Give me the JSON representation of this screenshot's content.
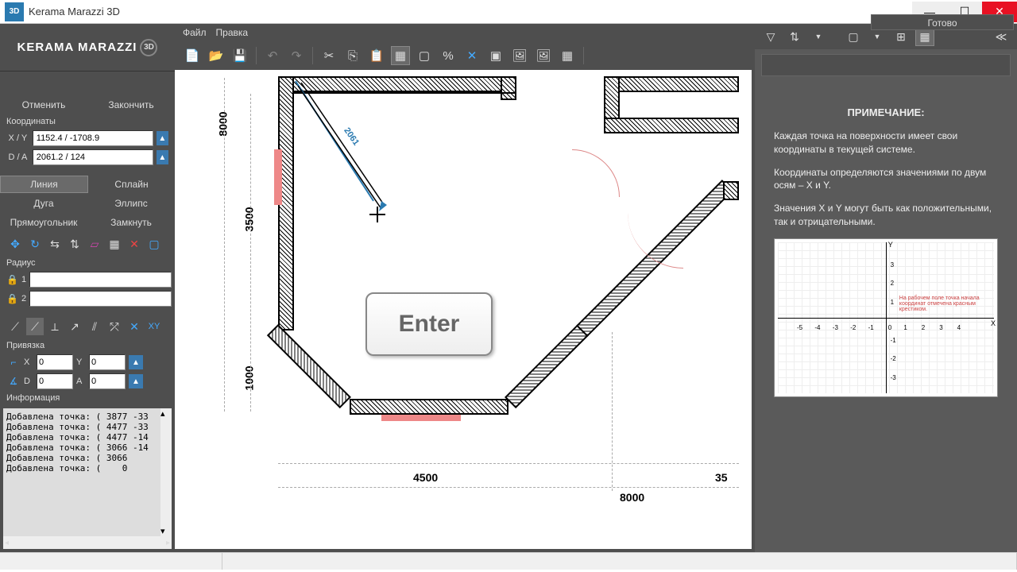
{
  "titlebar": {
    "app_icon_text": "3D",
    "title": "Kerama Marazzi 3D"
  },
  "status_ready": "Готово",
  "logo": {
    "text": "KERAMA MARAZZI",
    "badge": "3D"
  },
  "left": {
    "cancel": "Отменить",
    "finish": "Закончить",
    "coords_label": "Координаты",
    "xy_label": "X / Y",
    "xy_value": "1152.4 / -1708.9",
    "da_label": "D / A",
    "da_value": "2061.2 / 124",
    "tools": {
      "line": "Линия",
      "spline": "Сплайн",
      "arc": "Дуга",
      "ellipse": "Эллипс",
      "rect": "Прямоугольник",
      "close": "Замкнуть"
    },
    "radius_label": "Радиус",
    "r1": "1",
    "r2": "2",
    "snap_label": "Привязка",
    "snapX_label": "X",
    "snapX_value": "0",
    "snapY_label": "Y",
    "snapY_value": "0",
    "snapD_label": "D",
    "snapD_value": "0",
    "snapA_label": "A",
    "snapA_value": "0",
    "info_label": "Информация",
    "log_lines": [
      "Добавлена точка: ( 3877 -33",
      "Добавлена точка: ( 4477 -33",
      "Добавлена точка: ( 4477 -14",
      "Добавлена точка: ( 3066 -14",
      "Добавлена точка: ( 3066",
      "Добавлена точка: (    0"
    ]
  },
  "menu": {
    "file": "Файл",
    "edit": "Правка"
  },
  "canvas": {
    "enter_label": "Enter",
    "measure_label": "2061",
    "dims": {
      "d8000_left": "8000",
      "d3500": "3500",
      "d1000": "1000",
      "d4500": "4500",
      "d8000_bottom": "8000",
      "d35_right": "35"
    }
  },
  "note": {
    "title": "ПРИМЕЧАНИЕ:",
    "p1": "Каждая точка на поверхности имеет свои координаты в текущей системе.",
    "p2": "Координаты определяются значениями по двум осям – X и Y.",
    "p3": "Значения X и Y могут быть как положительными, так и отрицательными."
  }
}
